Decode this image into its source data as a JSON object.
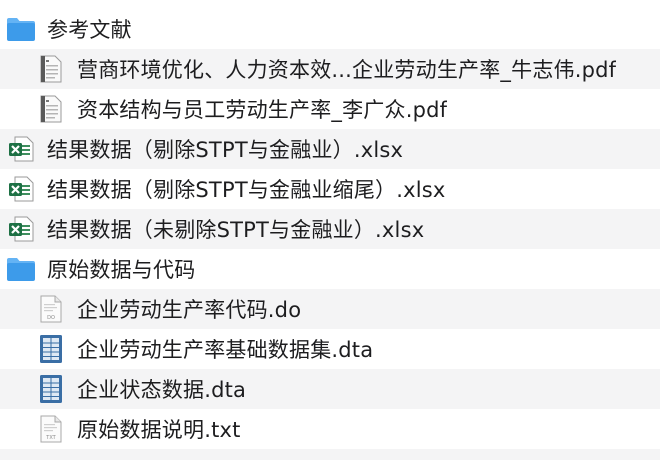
{
  "file_list": [
    {
      "name": "参考文献",
      "kind": "folder",
      "icon": "folder-icon",
      "level": 0,
      "accent": "#3d9bea"
    },
    {
      "name": "营商环境优化、人力资本效...企业劳动生产率_牛志伟.pdf",
      "kind": "pdf",
      "icon": "pdf-file-icon",
      "level": 1
    },
    {
      "name": "资本结构与员工劳动生产率_李广众.pdf",
      "kind": "pdf",
      "icon": "pdf-file-icon",
      "level": 1
    },
    {
      "name": "结果数据（剔除STPT与金融业）.xlsx",
      "kind": "excel",
      "icon": "excel-file-icon",
      "level": 0,
      "accent": "#1d7044"
    },
    {
      "name": "结果数据（剔除STPT与金融业缩尾）.xlsx",
      "kind": "excel",
      "icon": "excel-file-icon",
      "level": 0,
      "accent": "#1d7044"
    },
    {
      "name": "结果数据（未剔除STPT与金融业）.xlsx",
      "kind": "excel",
      "icon": "excel-file-icon",
      "level": 0,
      "accent": "#1d7044"
    },
    {
      "name": "原始数据与代码",
      "kind": "folder",
      "icon": "folder-icon",
      "level": 0,
      "accent": "#3d9bea"
    },
    {
      "name": "企业劳动生产率代码.do",
      "kind": "do",
      "icon": "do-file-icon",
      "badge": "DO",
      "level": 1
    },
    {
      "name": "企业劳动生产率基础数据集.dta",
      "kind": "dta",
      "icon": "dta-file-icon",
      "level": 1,
      "accent": "#3a6ea5"
    },
    {
      "name": "企业状态数据.dta",
      "kind": "dta",
      "icon": "dta-file-icon",
      "level": 1,
      "accent": "#3a6ea5"
    },
    {
      "name": "原始数据说明.txt",
      "kind": "txt",
      "icon": "txt-file-icon",
      "badge": "TXT",
      "level": 1
    }
  ]
}
